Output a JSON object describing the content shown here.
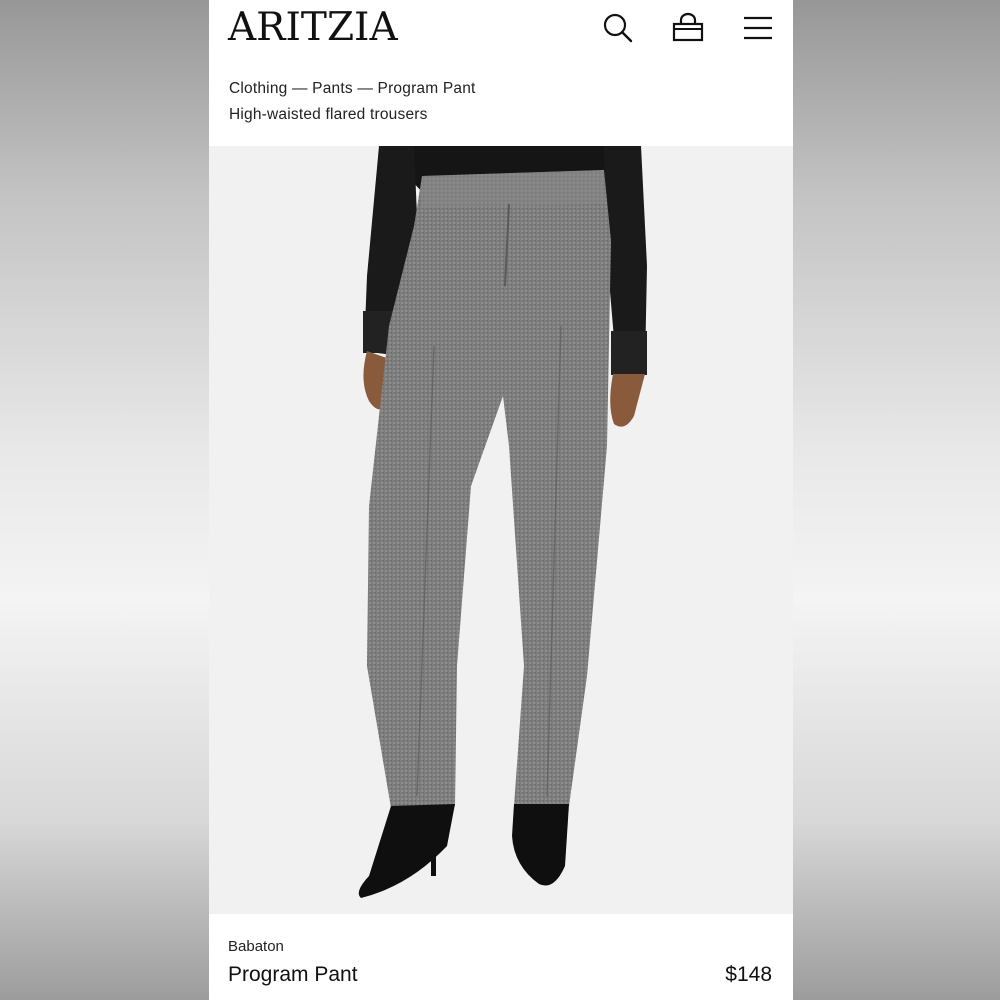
{
  "header": {
    "logo": "ARITZIA",
    "icons": [
      "search-icon",
      "bag-icon",
      "menu-icon"
    ]
  },
  "breadcrumb": {
    "text": "Clothing — Pants — Program Pant"
  },
  "page_subtitle": "High-waisted flared trousers",
  "product": {
    "brand": "Babaton",
    "name": "Program Pant",
    "price": "$148"
  }
}
